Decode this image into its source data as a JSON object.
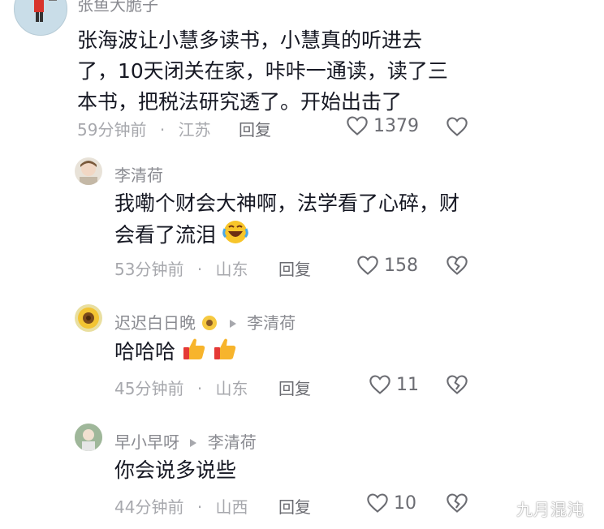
{
  "comments": [
    {
      "author": "张鱼大脆子",
      "text_lines": [
        "张海波让小慧多读书，小慧真的听进去",
        "了，10天闭关在家，咔咔一通读，读了三",
        "本书，把税法研究透了。开始出击了"
      ],
      "time": "59分钟前",
      "location": "江苏",
      "reply_label": "回复",
      "likes": "1379"
    },
    {
      "author": "李清荷",
      "text_lines": [
        "我嘞个财会大神啊，法学看了心碎，财",
        "会看了流泪"
      ],
      "time": "53分钟前",
      "location": "山东",
      "reply_label": "回复",
      "likes": "158"
    },
    {
      "author": "迟迟白日晚",
      "reply_to": "李清荷",
      "text": "哈哈哈",
      "time": "45分钟前",
      "location": "山东",
      "reply_label": "回复",
      "likes": "11"
    },
    {
      "author": "早小早呀",
      "reply_to": "李清荷",
      "text": "你会说多说些",
      "time": "44分钟前",
      "location": "山西",
      "reply_label": "回复",
      "likes": "10"
    }
  ],
  "separator": "·",
  "watermark": "九月混沌",
  "icons": {
    "like": "heart-outline-icon",
    "dislike": "broken-heart-icon",
    "reply_arrow": "triangle-right-icon",
    "emoji_laugh": "rolling-laughing-emoji",
    "emoji_thumbs": "thumbs-up-emoji",
    "emoji_sunflower": "sunflower-emoji"
  },
  "colors": {
    "text": "#161823",
    "secondary": "#a7a8ad",
    "name": "#8a8b91"
  }
}
